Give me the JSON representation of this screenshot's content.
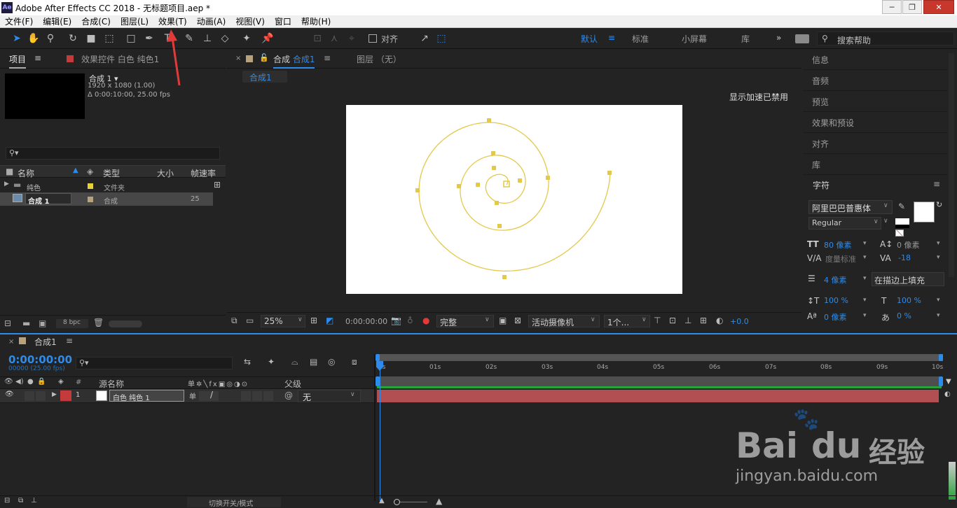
{
  "window": {
    "app_badge": "Ae",
    "title": "Adobe After Effects CC 2018 - 无标题项目.aep *",
    "controls": [
      "─",
      "❐",
      "✕"
    ]
  },
  "menu": [
    "文件(F)",
    "编辑(E)",
    "合成(C)",
    "图层(L)",
    "效果(T)",
    "动画(A)",
    "视图(V)",
    "窗口",
    "帮助(H)"
  ],
  "toolbar": {
    "align_label": "对齐",
    "workspaces": [
      "默认",
      "标准",
      "小屏幕",
      "库"
    ],
    "more": "»",
    "search_help": "搜索帮助"
  },
  "project": {
    "tab_project": "项目",
    "tab_menu": "≡",
    "tab_effects": "效果控件 白色 纯色1",
    "comp_name": "合成 1 ▾",
    "comp_size": "1920 x 1080 (1.00)",
    "comp_duration": "Δ 0:00:10:00, 25.00 fps",
    "search_placeholder": "",
    "columns": [
      "名称",
      "类型",
      "大小",
      "帧速率"
    ],
    "rows": [
      {
        "name": "纯色",
        "type": "文件夹",
        "size": "",
        "rate": "",
        "color": "#e5d13a",
        "icon": "folder-icon"
      },
      {
        "name": "合成 1",
        "type": "合成",
        "size": "",
        "rate": "25",
        "color": "#b8a27e",
        "icon": "composition-icon"
      }
    ],
    "bpc": "8 bpc"
  },
  "viewer": {
    "tab_comp_prefix": "合成",
    "tab_comp_name": "合成1",
    "tab_layer": "图层 （无）",
    "breadcrumb": "合成1",
    "gpu_notice": "显示加速已禁用",
    "zoom": "25%",
    "time": "0:00:00:00",
    "resolution": "完整",
    "camera": "活动摄像机",
    "views": "1个...",
    "exposure": "+0.0"
  },
  "right": {
    "panels": [
      "信息",
      "音频",
      "预览",
      "效果和预设",
      "对齐",
      "库"
    ],
    "character_title": "字符",
    "font_family": "阿里巴巴普惠体",
    "font_style": "Regular",
    "font_size": "80 像素",
    "leading": "0 像素",
    "kerning": "度量标准",
    "tracking": "-18",
    "stroke_width": "4 像素",
    "stroke_type": "在描边上填充",
    "vscale": "100 %",
    "hscale": "100 %",
    "baseline": "0 像素",
    "tsume": "0 %"
  },
  "timeline": {
    "tab": "合成1",
    "timecode": "0:00:00:00",
    "timecode_sub": "00000 (25.00 fps)",
    "columns": [
      "源名称",
      "父级"
    ],
    "layer": {
      "num": "1",
      "name": "白色 纯色 1",
      "parent": "无",
      "label_color": "#c43b3b"
    },
    "ticks": [
      "0s",
      "01s",
      "02s",
      "03s",
      "04s",
      "05s",
      "06s",
      "07s",
      "08s",
      "09s",
      "10s"
    ],
    "footer_toggle": "切换开关/模式"
  },
  "watermark": {
    "brand": "Bai",
    "brand2": "du",
    "cn": "经验",
    "url": "jingyan.baidu.com"
  },
  "colors": {
    "accent_blue": "#2d8ceb",
    "spiral": "#e3c94a",
    "layer_bar": "#b24f53",
    "arrow_red": "#e03b3b"
  }
}
